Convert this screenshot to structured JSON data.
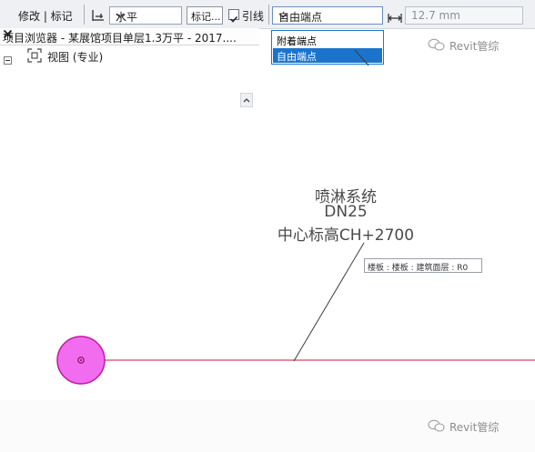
{
  "toolbar": {
    "mode_label": "修改 | 标记",
    "orientation_value": "水平",
    "tag_button_label": "标记...",
    "leader_checked": true,
    "leader_label": "引线",
    "endpoint_value": "自由端点",
    "leader_length_value": "12.7 mm"
  },
  "dropdown_menu": {
    "items": [
      {
        "label": "附着端点",
        "highlighted": false
      },
      {
        "label": "自由端点",
        "highlighted": true
      }
    ]
  },
  "project_browser": {
    "title": "项目浏览器 - 某展馆项目单层1.3万平 - 2017....",
    "tree_root_label": "视图 (专业)"
  },
  "watermark": {
    "text": "Revit管综"
  },
  "annotation": {
    "line1": "喷淋系统",
    "line2": "DN25",
    "line3": "中心标高CH+2700"
  },
  "tooltip": {
    "text": "楼板 : 楼板 : 建筑面层 : R0"
  },
  "colors": {
    "accent": "#1a74cc",
    "pipe_line": "#e0455a",
    "pipe_circle_fill": "#f26cf0",
    "pipe_circle_stroke": "#c2179e",
    "leader_line": "#3d3d3d"
  },
  "icons": {
    "dimension": "dimension-icon",
    "chevron": "chevron-down-icon",
    "close": "close-icon",
    "collapse": "tree-collapse-icon",
    "view_group": "view-group-icon",
    "scroll_up": "scroll-up-icon",
    "wechat": "wechat-icon",
    "length": "length-arrow-icon"
  }
}
